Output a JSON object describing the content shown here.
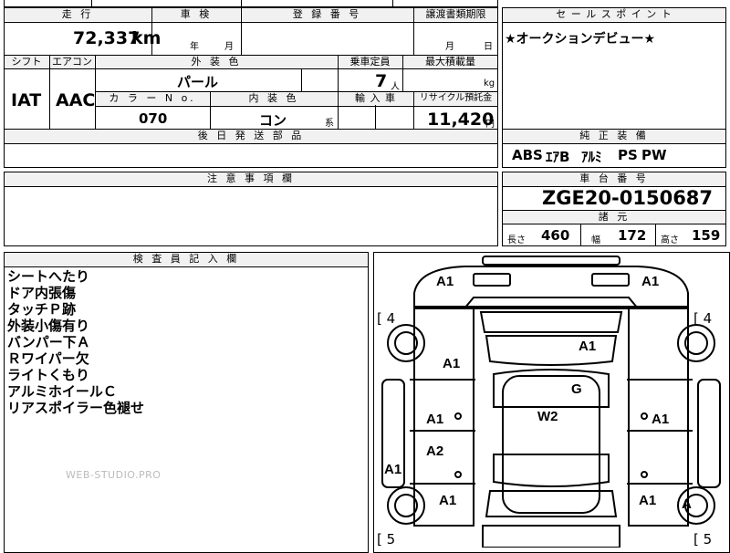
{
  "header": {
    "mileage_label": "走 行",
    "shaken_label": "車 検",
    "reg_label": "登 録 番 号",
    "transfer_label": "譲渡書類期限",
    "sales_label": "セ ー ル ス ポ イ ン ト"
  },
  "mileage": {
    "value": "72,337",
    "unit": "km"
  },
  "shaken": {
    "year": "年",
    "month": "月"
  },
  "transfer": {
    "month": "月",
    "day": "日"
  },
  "sales_point": "★オークションデビュー★",
  "spec_labels": {
    "shift": "シフト",
    "aircon": "エアコン",
    "ext_color": "外 装 色",
    "capacity": "乗車定員",
    "max_load": "最大積載量",
    "color_no": "カ ラ ー N o.",
    "int_color": "内 装 色",
    "import": "輸 入 車",
    "recycle": "リサイクル預託金"
  },
  "spec": {
    "shift": "IAT",
    "aircon": "AAC",
    "ext_color": "パール",
    "capacity": "7",
    "capacity_unit": "人",
    "max_load_unit": "kg",
    "color_no": "070",
    "int_color": "コン",
    "int_suffix": "系",
    "recycle": "11,420",
    "recycle_unit": "円"
  },
  "later_parts_label": "後 日 発 送 部 品",
  "equipment_label": "純 正 装 備",
  "equipment": [
    "ABS",
    "ｴｱB",
    "ｱﾙﾐ",
    "PS",
    "PW"
  ],
  "caution_label": "注 意 事 項 欄",
  "chassis_label": "車 台 番 号",
  "chassis_no": "ZGE20-0150687",
  "dims_label": "諸 元",
  "dims": {
    "length_label": "長さ",
    "length": "460",
    "width_label": "幅",
    "width": "172",
    "height_label": "高さ",
    "height": "159"
  },
  "inspector_label": "検 査 員 記 入 欄",
  "inspector_notes": [
    "シートへたり",
    "ドア内張傷",
    "タッチＰ跡",
    "外装小傷有り",
    "バンパー下Ａ",
    "Ｒワイパー欠",
    "ライトくもり",
    "アルミホイールＣ",
    "リアスポイラー色褪せ"
  ],
  "watermark": "WEB-STUDIO.PRO",
  "diagram": {
    "marks": [
      "A1",
      "A1",
      "A1",
      "A1",
      "G",
      "W2",
      "A1",
      "A1",
      "A2",
      "A1",
      "A1",
      "A1",
      "A"
    ],
    "score_fl": "[ 4",
    "score_fr": "[ 4",
    "score_rl": "[ 5",
    "score_rr": "[ 5"
  }
}
